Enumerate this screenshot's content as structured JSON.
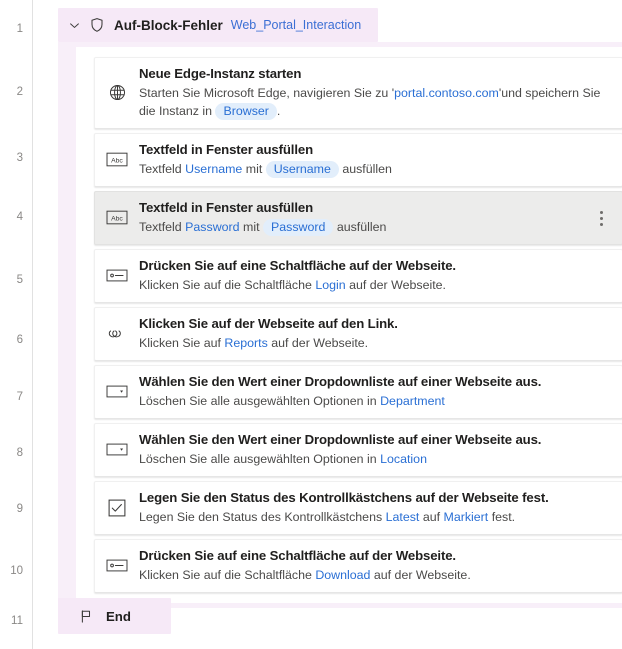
{
  "gutter": {
    "line_numbers": [
      "1",
      "2",
      "3",
      "4",
      "5",
      "6",
      "7",
      "8",
      "9",
      "10",
      "11"
    ]
  },
  "colors": {
    "block_header_bg": "#f6e9f7",
    "block_rail_bg": "#f8eff9",
    "link_blue": "#2a6fd4",
    "pill_bg": "#e2eefb",
    "selected_row_bg": "#ececeb",
    "title_text": "#201f1e",
    "desc_text": "#4b4a49",
    "gutter_text": "#8a8886"
  },
  "block": {
    "collapse_icon": "chevron-down-icon",
    "icon": "shield-icon",
    "title": "Auf-Block-Fehler",
    "subtitle": "Web_Portal_Interaction"
  },
  "actions": [
    {
      "icon": "globe-icon",
      "title": "Neue Edge-Instanz starten",
      "selected": false,
      "kebab": false,
      "desc_parts": [
        {
          "type": "text",
          "text": "Starten Sie Microsoft Edge, navigieren Sie zu '"
        },
        {
          "type": "link",
          "text": "portal.contoso.com"
        },
        {
          "type": "text",
          "text": "'und speichern Sie die Instanz in "
        },
        {
          "type": "pill",
          "text": "Browser"
        },
        {
          "type": "text",
          "text": "."
        }
      ]
    },
    {
      "icon": "textbox-abc-icon",
      "title": "Textfeld in Fenster ausfüllen",
      "selected": false,
      "kebab": false,
      "desc_parts": [
        {
          "type": "text",
          "text": "Textfeld "
        },
        {
          "type": "link",
          "text": "Username"
        },
        {
          "type": "text",
          "text": " mit "
        },
        {
          "type": "pill",
          "text": "Username"
        },
        {
          "type": "text",
          "text": " ausfüllen"
        }
      ]
    },
    {
      "icon": "textbox-abc-icon",
      "title": "Textfeld in Fenster ausfüllen",
      "selected": true,
      "kebab": true,
      "desc_parts": [
        {
          "type": "text",
          "text": "Textfeld "
        },
        {
          "type": "link",
          "text": "Password"
        },
        {
          "type": "text",
          "text": " mit "
        },
        {
          "type": "pill",
          "text": "Password"
        },
        {
          "type": "text",
          "text": " ausfüllen"
        }
      ]
    },
    {
      "icon": "button-press-icon",
      "title": "Drücken Sie auf eine Schaltfläche auf der Webseite.",
      "selected": false,
      "kebab": false,
      "desc_parts": [
        {
          "type": "text",
          "text": "Klicken Sie auf die Schaltfläche "
        },
        {
          "type": "link",
          "text": "Login"
        },
        {
          "type": "text",
          "text": " auf der Webseite."
        }
      ]
    },
    {
      "icon": "link-icon",
      "title": "Klicken Sie auf der Webseite auf den Link.",
      "selected": false,
      "kebab": false,
      "desc_parts": [
        {
          "type": "text",
          "text": "Klicken Sie auf "
        },
        {
          "type": "link",
          "text": "Reports"
        },
        {
          "type": "text",
          "text": " auf der Webseite."
        }
      ]
    },
    {
      "icon": "dropdown-icon",
      "title": "Wählen Sie den Wert einer Dropdownliste auf einer Webseite aus.",
      "selected": false,
      "kebab": false,
      "desc_parts": [
        {
          "type": "text",
          "text": "Löschen Sie alle ausgewählten Optionen in "
        },
        {
          "type": "link",
          "text": "Department"
        }
      ]
    },
    {
      "icon": "dropdown-icon",
      "title": "Wählen Sie den Wert einer Dropdownliste auf einer Webseite aus.",
      "selected": false,
      "kebab": false,
      "desc_parts": [
        {
          "type": "text",
          "text": "Löschen Sie alle ausgewählten Optionen in "
        },
        {
          "type": "link",
          "text": "Location"
        }
      ]
    },
    {
      "icon": "checkbox-icon",
      "title": "Legen Sie den Status des Kontrollkästchens auf der Webseite fest.",
      "selected": false,
      "kebab": false,
      "desc_parts": [
        {
          "type": "text",
          "text": "Legen Sie den Status des Kontrollkästchens "
        },
        {
          "type": "link",
          "text": "Latest"
        },
        {
          "type": "text",
          "text": " auf "
        },
        {
          "type": "link",
          "text": "Markiert"
        },
        {
          "type": "text",
          "text": " fest."
        }
      ]
    },
    {
      "icon": "button-press-icon",
      "title": "Drücken Sie auf eine Schaltfläche auf der Webseite.",
      "selected": false,
      "kebab": false,
      "desc_parts": [
        {
          "type": "text",
          "text": "Klicken Sie auf die Schaltfläche "
        },
        {
          "type": "link",
          "text": "Download"
        },
        {
          "type": "text",
          "text": " auf der Webseite."
        }
      ]
    }
  ],
  "end_block": {
    "icon": "flag-icon",
    "label": "End"
  }
}
